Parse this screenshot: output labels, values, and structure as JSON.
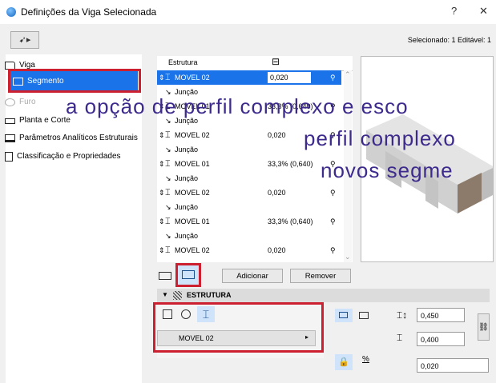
{
  "window": {
    "title": "Definições da Viga Selecionada",
    "help": "?",
    "close": "✕"
  },
  "toolbar": {
    "selector_icon": "favorite-arrow-icon"
  },
  "selection_info": "Selecionado: 1 Editável: 1",
  "sidebar": {
    "items": [
      {
        "label": "Viga",
        "icon": "beam-icon"
      },
      {
        "label": "Segmento",
        "icon": "segment-icon"
      },
      {
        "label": "Furo",
        "icon": "hole-icon"
      },
      {
        "label": "Planta e Corte",
        "icon": "floor-plan-icon"
      },
      {
        "label": "Parâmetros Analíticos Estruturais",
        "icon": "analytic-icon"
      },
      {
        "label": "Classificação e Propriedades",
        "icon": "properties-icon"
      }
    ]
  },
  "segments_table": {
    "header": {
      "col1": "Estrutura",
      "col2_icon": "height-icon"
    },
    "rows": [
      {
        "type": "segment",
        "name": "MOVEL 02",
        "value": "0,020"
      },
      {
        "type": "junction",
        "name": "Junção"
      },
      {
        "type": "segment",
        "name": "MOVEL 01",
        "value": "33,3% (0,640)"
      },
      {
        "type": "junction",
        "name": "Junção"
      },
      {
        "type": "segment",
        "name": "MOVEL 02",
        "value": "0,020"
      },
      {
        "type": "junction",
        "name": "Junção"
      },
      {
        "type": "segment",
        "name": "MOVEL 01",
        "value": "33,3% (0,640)"
      },
      {
        "type": "junction",
        "name": "Junção"
      },
      {
        "type": "segment",
        "name": "MOVEL 02",
        "value": "0,020"
      },
      {
        "type": "junction",
        "name": "Junção"
      },
      {
        "type": "segment",
        "name": "MOVEL 01",
        "value": "33,3% (0,640)"
      },
      {
        "type": "junction",
        "name": "Junção"
      },
      {
        "type": "segment",
        "name": "MOVEL 02",
        "value": "0,020"
      }
    ]
  },
  "buttons": {
    "add": "Adicionar",
    "remove": "Remover"
  },
  "structure": {
    "section_title": "ESTRUTURA",
    "profile_select": "MOVEL 02",
    "width": "0,450",
    "height": "0,400",
    "length": "0,020",
    "length_unit": "%"
  },
  "overlay_caption": {
    "line1": "a opção de perfil complexo e esco",
    "line2": "perfil complexo",
    "line3": "novos segme"
  },
  "colors": {
    "accent": "#1a73e8",
    "highlight_box": "#cc2030",
    "caption": "#3d2a8c"
  }
}
